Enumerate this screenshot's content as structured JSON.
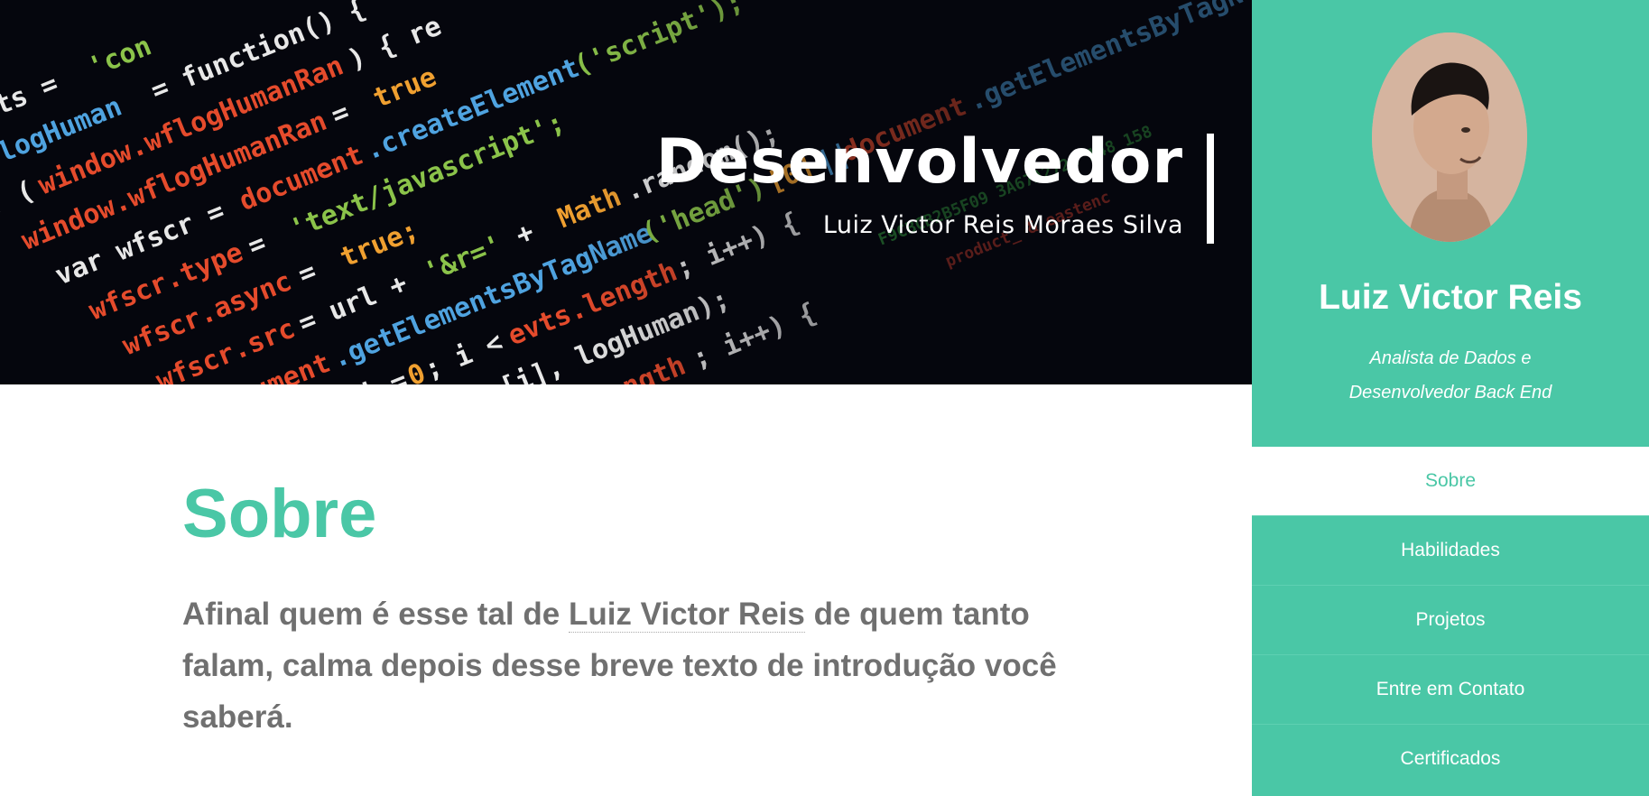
{
  "hero": {
    "title": "Desenvolvedor",
    "subtitle": "Luiz Victor Reis Moraes Silva"
  },
  "about": {
    "heading": "Sobre",
    "intro_before": "Afinal quem é esse tal de ",
    "intro_name": "Luiz Victor Reis",
    "intro_after": " de quem tanto falam, calma depois desse breve texto de introdução você saberá."
  },
  "sidebar": {
    "name": "Luiz Victor Reis",
    "role_line1": "Analista de Dados e",
    "role_line2": "Desenvolvedor Back End",
    "nav": [
      {
        "label": "Sobre",
        "active": true
      },
      {
        "label": "Habilidades"
      },
      {
        "label": "Projetos"
      },
      {
        "label": "Entre em Contato"
      },
      {
        "label": "Certificados"
      }
    ]
  },
  "colors": {
    "accent": "#4ac7a6",
    "text_gray": "#707070",
    "hero_bg": "#05060d"
  }
}
